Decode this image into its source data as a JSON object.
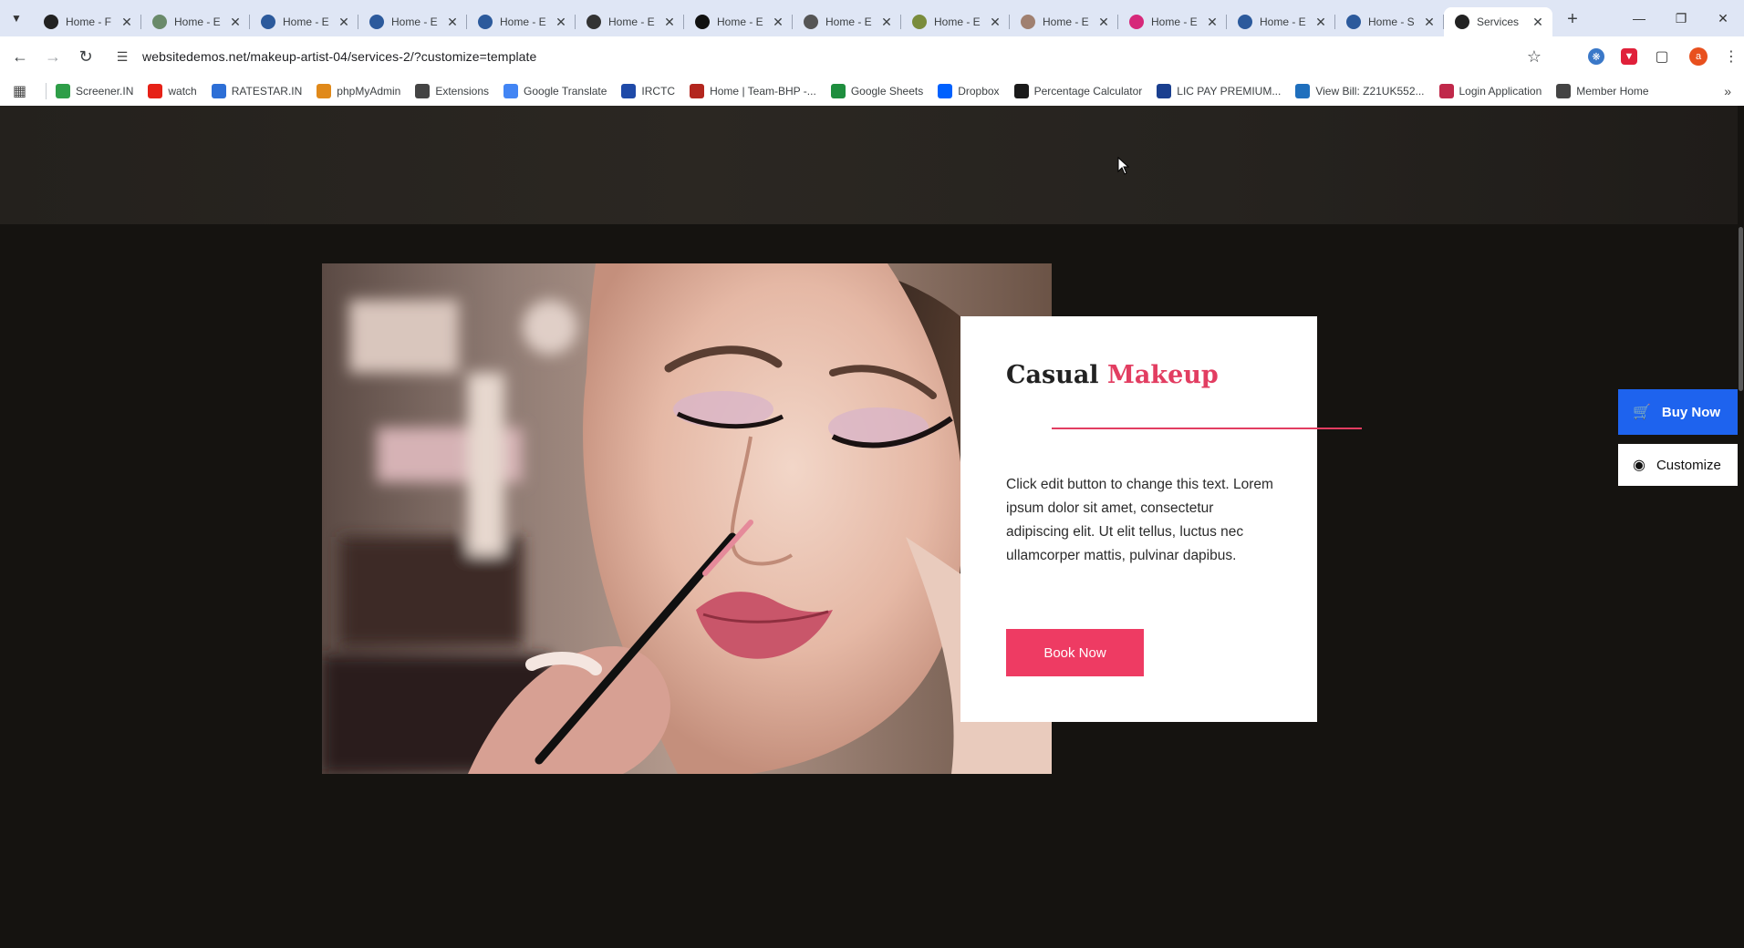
{
  "browser": {
    "tabs": [
      {
        "title": "Home - F",
        "favicon": "enk-icon",
        "color": "#222"
      },
      {
        "title": "Home - E",
        "favicon": "leaf-icon",
        "color": "#6a8a6a"
      },
      {
        "title": "Home - E",
        "favicon": "wordpress-icon",
        "color": "#2c5a9c"
      },
      {
        "title": "Home - E",
        "favicon": "wordpress-icon",
        "color": "#2c5a9c"
      },
      {
        "title": "Home - E",
        "favicon": "wordpress-icon",
        "color": "#2c5a9c"
      },
      {
        "title": "Home - E",
        "favicon": "ring-icon",
        "color": "#333"
      },
      {
        "title": "Home - E",
        "favicon": "kf-icon",
        "color": "#111"
      },
      {
        "title": "Home - E",
        "favicon": "script-icon",
        "color": "#555"
      },
      {
        "title": "Home - E",
        "favicon": "feather-icon",
        "color": "#7a8c3c"
      },
      {
        "title": "Home - E",
        "favicon": "circle-icon",
        "color": "#a08070"
      },
      {
        "title": "Home - E",
        "favicon": "y-icon",
        "color": "#d6287a"
      },
      {
        "title": "Home - E",
        "favicon": "wordpress-icon",
        "color": "#2c5a9c"
      },
      {
        "title": "Home - S",
        "favicon": "wordpress-icon",
        "color": "#2c5a9c"
      },
      {
        "title": "Services",
        "favicon": "compass-icon",
        "color": "#222",
        "active": true
      }
    ],
    "url": "websitedemos.net/makeup-artist-04/services-2/?customize=template",
    "profile_initial": "a",
    "bookmarks": [
      {
        "label": "Screener.IN",
        "icon": "bar-chart-icon",
        "color": "#2e9e48"
      },
      {
        "label": "watch",
        "icon": "youtube-icon",
        "color": "#e62117"
      },
      {
        "label": "RATESTAR.IN",
        "icon": "arrows-icon",
        "color": "#2d6fd6"
      },
      {
        "label": "phpMyAdmin",
        "icon": "sail-icon",
        "color": "#e0891a"
      },
      {
        "label": "Extensions",
        "icon": "puzzle-icon",
        "color": "#444"
      },
      {
        "label": "Google Translate",
        "icon": "translate-icon",
        "color": "#4285f4"
      },
      {
        "label": "IRCTC",
        "icon": "train-icon",
        "color": "#1f4aa8"
      },
      {
        "label": "Home | Team-BHP -...",
        "icon": "team-bhp-icon",
        "color": "#b3261e"
      },
      {
        "label": "Google Sheets",
        "icon": "sheets-icon",
        "color": "#1e8e3e"
      },
      {
        "label": "Dropbox",
        "icon": "dropbox-icon",
        "color": "#0061fe"
      },
      {
        "label": "Percentage Calculator",
        "icon": "percent-icon",
        "color": "#1a1a1a"
      },
      {
        "label": "LIC PAY PREMIUM...",
        "icon": "lic-icon",
        "color": "#1a3f8f"
      },
      {
        "label": "View Bill: Z21UK552...",
        "icon": "bill-icon",
        "color": "#1f6fbd"
      },
      {
        "label": "Login Application",
        "icon": "login-icon",
        "color": "#c0284a"
      },
      {
        "label": "Member Home",
        "icon": "globe-icon",
        "color": "#444"
      }
    ]
  },
  "page": {
    "card": {
      "title_plain": "Casual",
      "title_accent": "Makeup",
      "body": "Click edit button to change this text. Lorem ipsum dolor sit amet, consectetur adipiscing elit. Ut elit tellus, luctus nec ullamcorper mattis, pulvinar dapibus.",
      "button": "Book Now"
    },
    "side_buttons": {
      "buy": "Buy Now",
      "customize": "Customize"
    },
    "colors": {
      "accent": "#e23d61",
      "button": "#ee3b63",
      "buy": "#1e63ee",
      "background": "#151310"
    }
  }
}
